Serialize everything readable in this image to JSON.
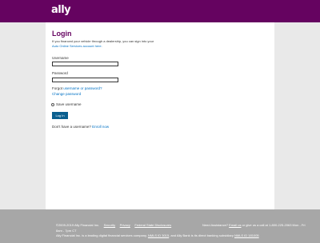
{
  "header": {
    "logo": "ally"
  },
  "login": {
    "title": "Login",
    "intro_text": "If you financed your vehicle through a dealership, you can sign into your",
    "intro_link": "Auto Online Services account here.",
    "username_label": "Username",
    "password_label": "Password",
    "forgot_prefix": "Forgot",
    "forgot_link": "username or password?",
    "change_password": "Change password",
    "save_username": "Save username",
    "login_button": "Log In",
    "no_account_text": "Don't have a username?",
    "enroll_link": "Enroll now"
  },
  "footer": {
    "copyright": "©2009-2019 Ally Financial Inc.",
    "security": "Security",
    "privacy": "Privacy",
    "disclosures": "Federal State Disclosures",
    "hours": "8am - 7pm CT",
    "disclaimer_text": "Ally Financial Inc. is a leading digital financial services company,",
    "nmls1": "NMLS ID 3015",
    "disclaimer_mid": ", and Ally Bank is its direct banking subsidiary",
    "nmls2": "NMLS ID 181005",
    "help_text": "Need Assistance?",
    "email_link": "Email us",
    "call_text": "or give us a call at 1-800-225-2063 Mon - Fri"
  },
  "colors": {
    "brand": "#650360",
    "link": "#0071c4",
    "button": "#0a5f8f",
    "footer": "#a7a7a7"
  }
}
